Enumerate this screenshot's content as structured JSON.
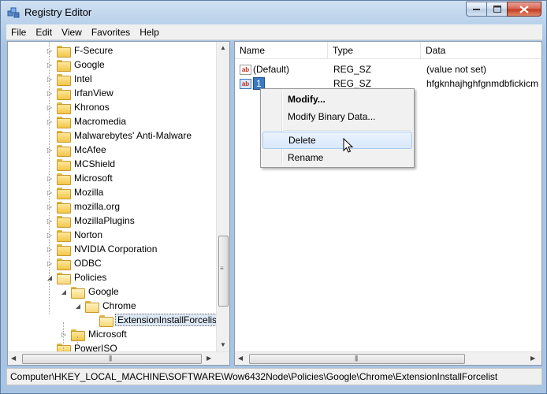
{
  "window": {
    "title": "Registry Editor"
  },
  "menu": [
    "File",
    "Edit",
    "View",
    "Favorites",
    "Help"
  ],
  "tree": [
    {
      "label": "F-Secure",
      "expander": "▷"
    },
    {
      "label": "Google",
      "expander": "▷"
    },
    {
      "label": "Intel",
      "expander": "▷"
    },
    {
      "label": "IrfanView",
      "expander": "▷"
    },
    {
      "label": "Khronos",
      "expander": "▷"
    },
    {
      "label": "Macromedia",
      "expander": "▷"
    },
    {
      "label": "Malwarebytes' Anti-Malware",
      "expander": ""
    },
    {
      "label": "McAfee",
      "expander": "▷"
    },
    {
      "label": "MCShield",
      "expander": ""
    },
    {
      "label": "Microsoft",
      "expander": "▷"
    },
    {
      "label": "Mozilla",
      "expander": "▷"
    },
    {
      "label": "mozilla.org",
      "expander": "▷"
    },
    {
      "label": "MozillaPlugins",
      "expander": "▷"
    },
    {
      "label": "Norton",
      "expander": "▷"
    },
    {
      "label": "NVIDIA Corporation",
      "expander": "▷"
    },
    {
      "label": "ODBC",
      "expander": "▷"
    },
    {
      "label": "Policies",
      "expander": "◢"
    },
    {
      "label": "Google",
      "expander": "◢"
    },
    {
      "label": "Chrome",
      "expander": "◢"
    },
    {
      "label": "ExtensionInstallForcelist",
      "expander": ""
    },
    {
      "label": "Microsoft",
      "expander": "▷"
    },
    {
      "label": "PowerISO",
      "expander": ""
    }
  ],
  "list": {
    "columns": [
      "Name",
      "Type",
      "Data"
    ],
    "rows": [
      {
        "name": "(Default)",
        "type": "REG_SZ",
        "data": "(value not set)"
      },
      {
        "name": "1",
        "type": "REG_SZ",
        "data": "hfgknhajhghfgnmdbfickicm"
      }
    ]
  },
  "context_menu": {
    "items": [
      "Modify...",
      "Modify Binary Data...",
      "Delete",
      "Rename"
    ]
  },
  "status_bar": "Computer\\HKEY_LOCAL_MACHINE\\SOFTWARE\\Wow6432Node\\Policies\\Google\\Chrome\\ExtensionInstallForcelist",
  "icons": {
    "folder": "folder-icon",
    "string_value": "string-value-icon",
    "app": "registry-editor-icon"
  }
}
